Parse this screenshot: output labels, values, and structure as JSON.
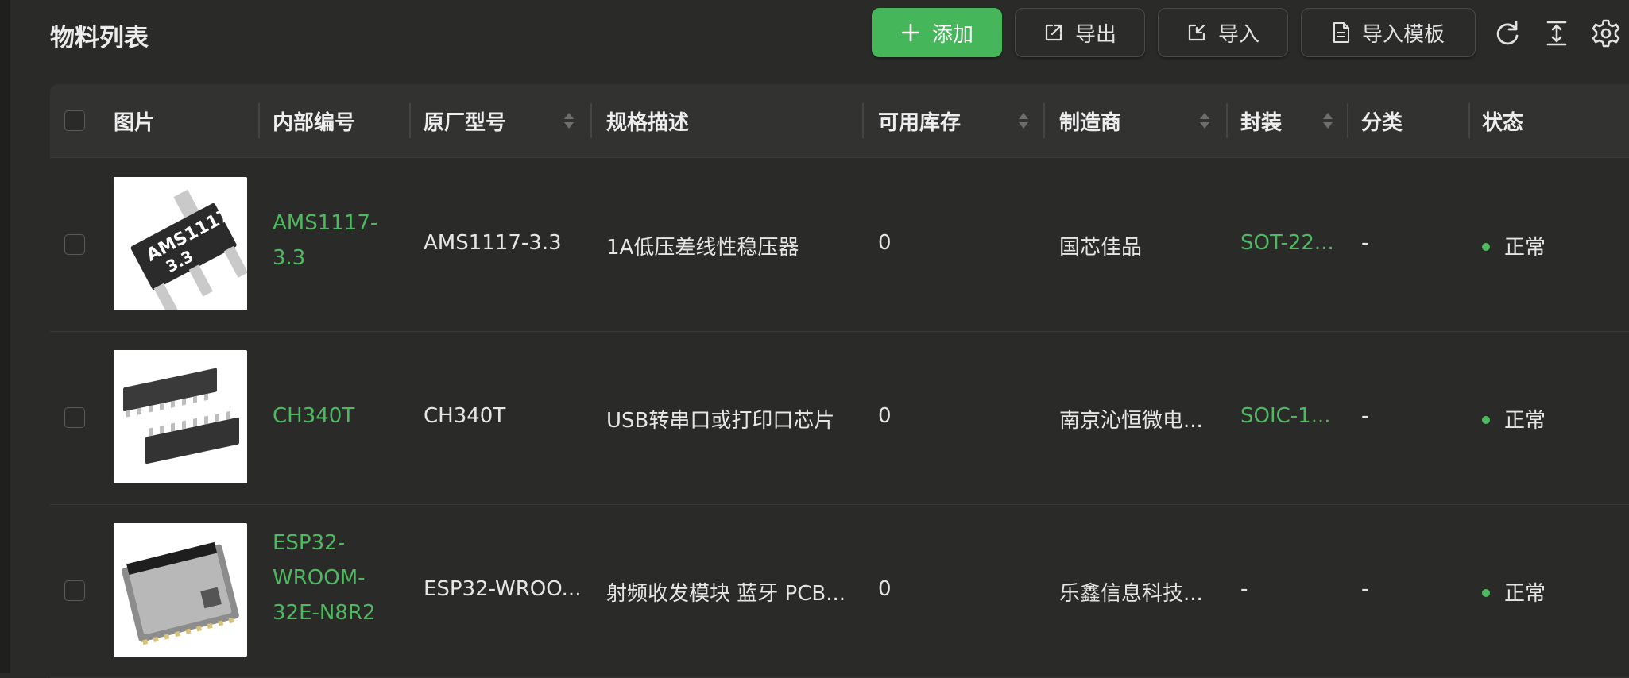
{
  "header": {
    "title": "物料列表",
    "buttons": {
      "add": "添加",
      "export": "导出",
      "import": "导入",
      "import_template": "导入模板"
    },
    "icons": [
      "refresh-icon",
      "column-height-icon",
      "settings-icon"
    ]
  },
  "table": {
    "columns": [
      "图片",
      "内部编号",
      "原厂型号",
      "规格描述",
      "可用库存",
      "制造商",
      "封装",
      "分类",
      "状态"
    ],
    "rows": [
      {
        "image": "AMS1117-3.3 SOT-223 package photo",
        "image_text": [
          "AMS1117",
          "3.3"
        ],
        "internal_no": "AMS1117-3.3",
        "part_no": "AMS1117-3.3",
        "description": "1A低压差线性稳压器",
        "stock": "0",
        "manufacturer": "国芯佳品",
        "package": "SOT-22...",
        "category": "-",
        "status": "正常"
      },
      {
        "image": "CH340T SOIC package photo",
        "internal_no": "CH340T",
        "part_no": "CH340T",
        "description": "USB转串口或打印口芯片",
        "stock": "0",
        "manufacturer": "南京沁恒微电...",
        "package": "SOIC-1...",
        "category": "-",
        "status": "正常"
      },
      {
        "image": "ESP32 module photo",
        "internal_no": "ESP32-WROOM-32E-N8R2",
        "part_no": "ESP32-WROO...",
        "description": "射频收发模块 蓝牙 PCB...",
        "stock": "0",
        "manufacturer": "乐鑫信息科技...",
        "package": "-",
        "category": "-",
        "status": "正常"
      }
    ]
  },
  "colors": {
    "accent_green": "#45b65a",
    "link_green": "#4fb961",
    "background": "#2a2a29",
    "header_bg": "#323231"
  }
}
